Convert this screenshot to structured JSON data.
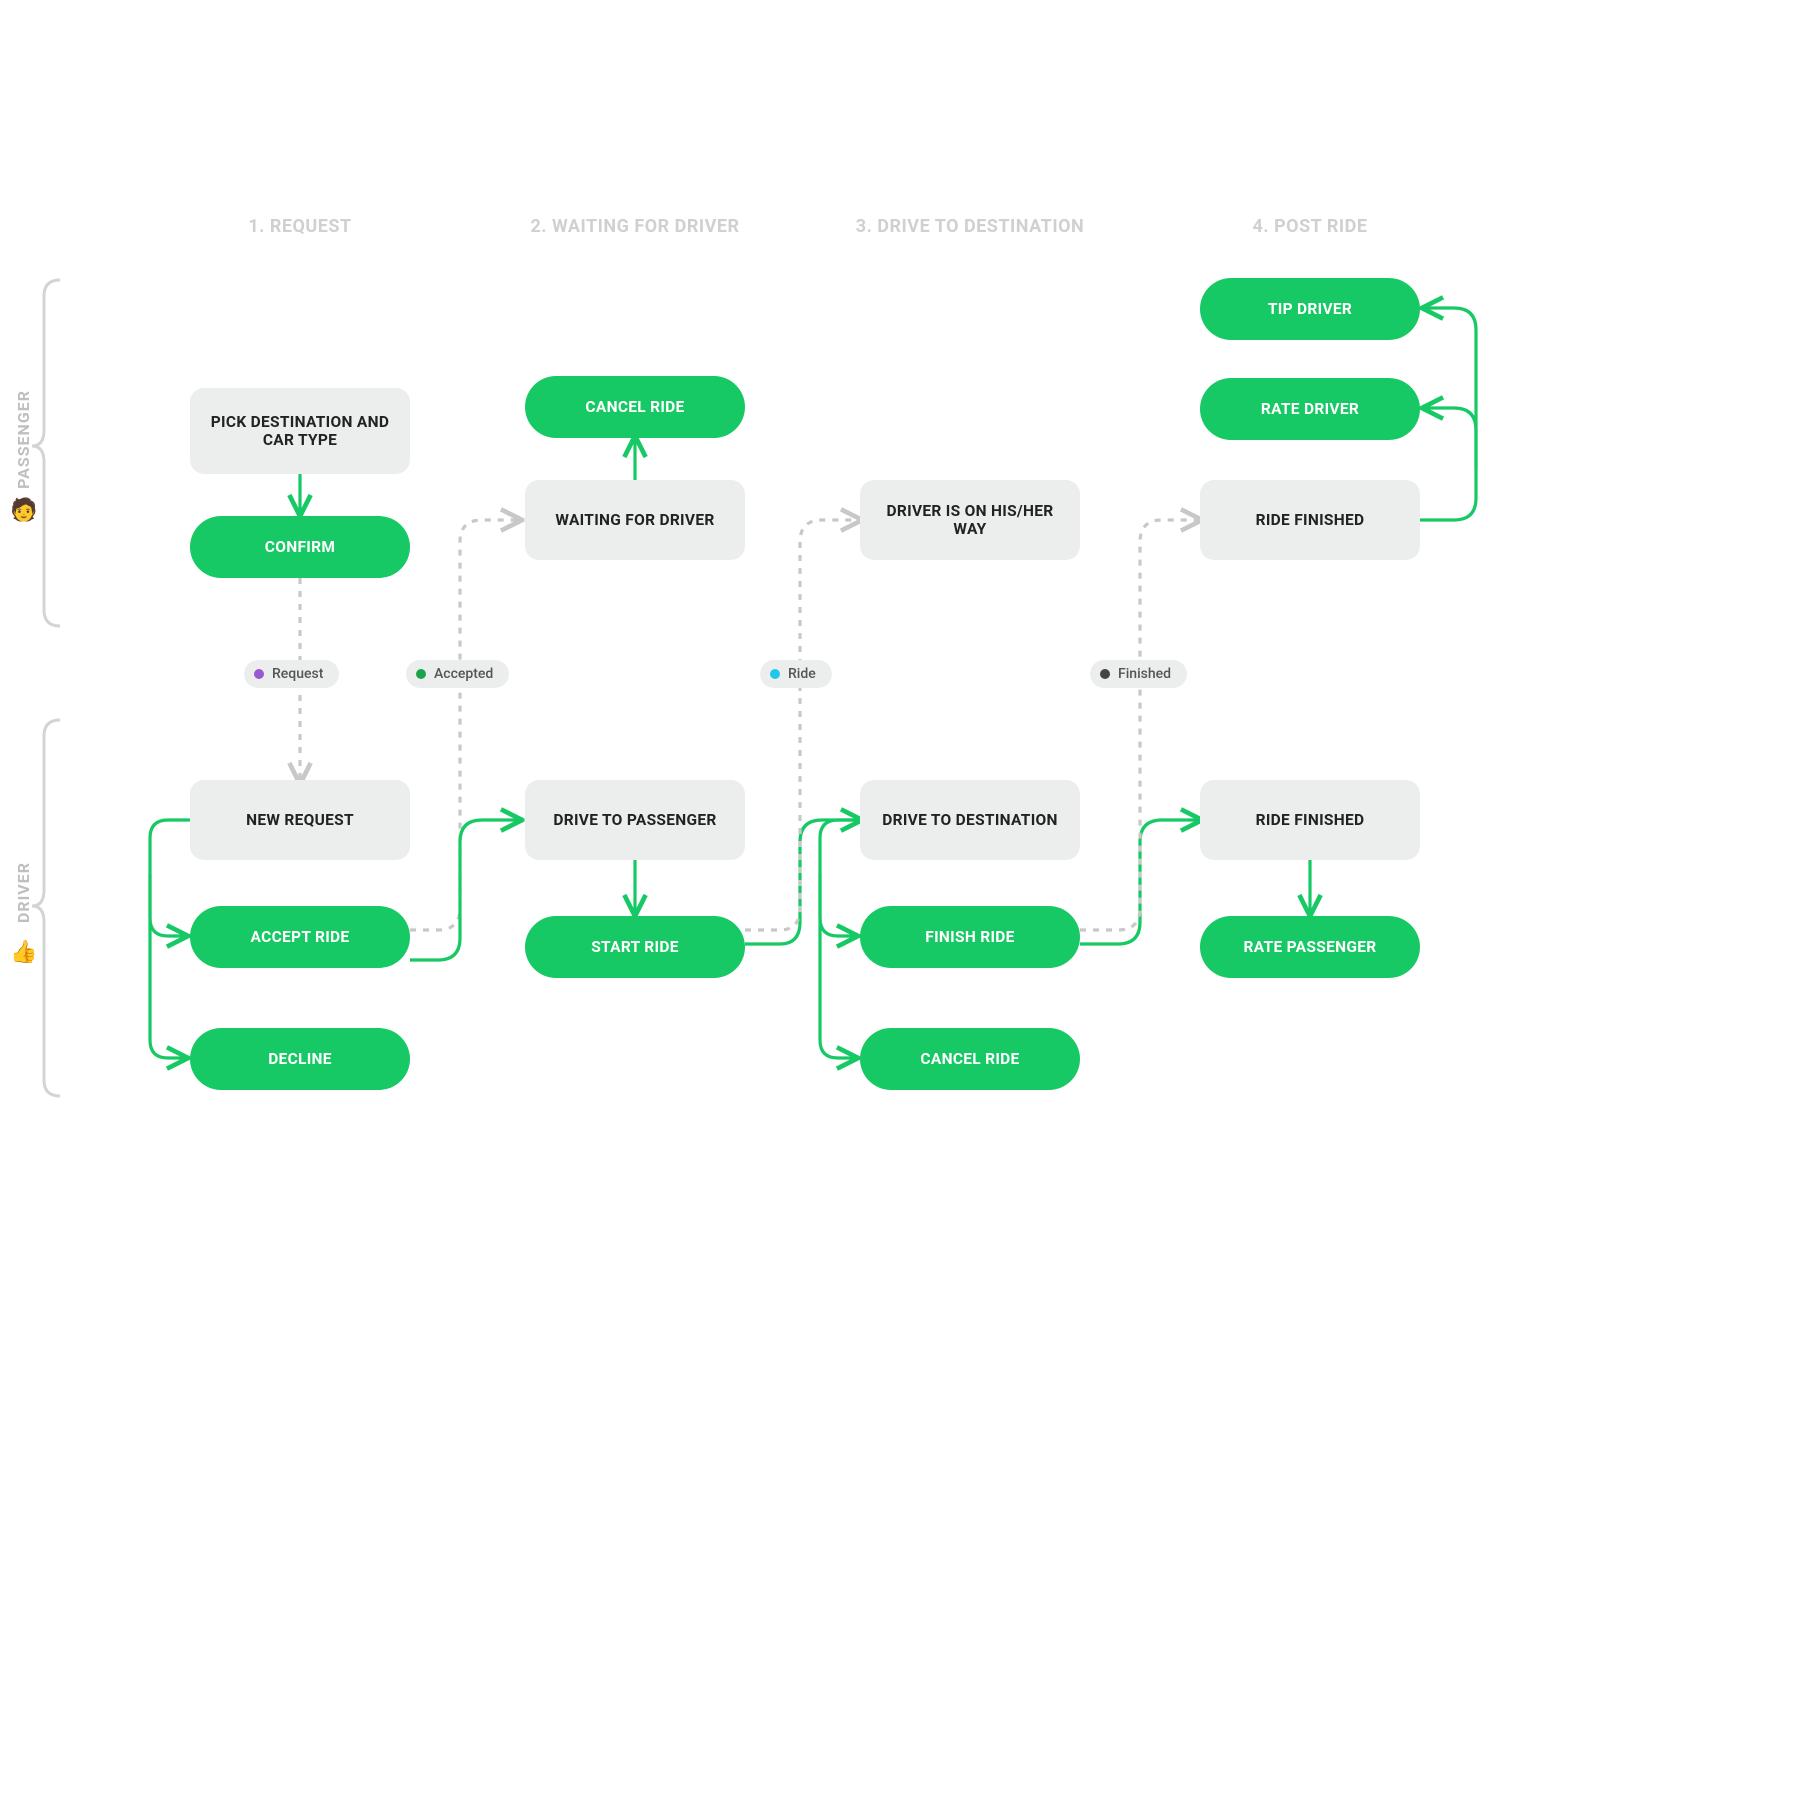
{
  "lanes": {
    "passenger": {
      "label": "PASSENGER",
      "emoji": "🧑"
    },
    "driver": {
      "label": "DRIVER",
      "emoji": "👍"
    }
  },
  "phases": [
    {
      "id": "p1",
      "label": "1. REQUEST"
    },
    {
      "id": "p2",
      "label": "2. WAITING FOR DRIVER"
    },
    {
      "id": "p3",
      "label": "3. DRIVE TO DESTINATION"
    },
    {
      "id": "p4",
      "label": "4. POST RIDE"
    }
  ],
  "badges": [
    {
      "id": "b-request",
      "label": "Request",
      "color": "#9b59d0"
    },
    {
      "id": "b-accepted",
      "label": "Accepted",
      "color": "#1aa34a"
    },
    {
      "id": "b-ride",
      "label": "Ride",
      "color": "#22c7e8"
    },
    {
      "id": "b-finished",
      "label": "Finished",
      "color": "#444444"
    }
  ],
  "nodes": {
    "pickDest": {
      "label": "PICK DESTINATION AND CAR TYPE",
      "type": "state"
    },
    "confirm": {
      "label": "CONFIRM",
      "type": "action"
    },
    "cancelRideP": {
      "label": "CANCEL RIDE",
      "type": "action"
    },
    "waitingDriver": {
      "label": "WAITING FOR DRIVER",
      "type": "state"
    },
    "driverOnWay": {
      "label": "DRIVER IS ON HIS/HER WAY",
      "type": "state"
    },
    "rideFinishedP": {
      "label": "RIDE FINISHED",
      "type": "state"
    },
    "tipDriver": {
      "label": "TIP DRIVER",
      "type": "action"
    },
    "rateDriver": {
      "label": "RATE DRIVER",
      "type": "action"
    },
    "newRequest": {
      "label": "NEW REQUEST",
      "type": "state"
    },
    "acceptRide": {
      "label": "ACCEPT RIDE",
      "type": "action"
    },
    "decline": {
      "label": "DECLINE",
      "type": "action"
    },
    "driveToPassenger": {
      "label": "DRIVE TO PASSENGER",
      "type": "state"
    },
    "startRide": {
      "label": "START RIDE",
      "type": "action"
    },
    "driveToDest": {
      "label": "DRIVE TO DESTINATION",
      "type": "state"
    },
    "finishRide": {
      "label": "FINISH RIDE",
      "type": "action"
    },
    "cancelRideD": {
      "label": "CANCEL RIDE",
      "type": "action"
    },
    "rideFinishedD": {
      "label": "RIDE FINISHED",
      "type": "state"
    },
    "ratePassenger": {
      "label": "RATE PASSENGER",
      "type": "action"
    }
  },
  "connections": [
    {
      "from": "pickDest",
      "to": "confirm",
      "style": "solid"
    },
    {
      "from": "confirm",
      "to": "newRequest",
      "style": "dash",
      "label": "Request"
    },
    {
      "from": "newRequest",
      "to": "acceptRide",
      "style": "solid"
    },
    {
      "from": "newRequest",
      "to": "decline",
      "style": "solid"
    },
    {
      "from": "acceptRide",
      "to": "driveToPassenger",
      "style": "solid"
    },
    {
      "from": "acceptRide",
      "to": "waitingDriver",
      "style": "dash",
      "label": "Accepted"
    },
    {
      "from": "waitingDriver",
      "to": "cancelRideP",
      "style": "solid"
    },
    {
      "from": "driveToPassenger",
      "to": "startRide",
      "style": "solid"
    },
    {
      "from": "startRide",
      "to": "driveToDest",
      "style": "solid"
    },
    {
      "from": "startRide",
      "to": "driverOnWay",
      "style": "dash",
      "label": "Ride"
    },
    {
      "from": "driveToDest",
      "to": "finishRide",
      "style": "solid"
    },
    {
      "from": "driveToDest",
      "to": "cancelRideD",
      "style": "solid"
    },
    {
      "from": "finishRide",
      "to": "rideFinishedD",
      "style": "solid"
    },
    {
      "from": "finishRide",
      "to": "rideFinishedP",
      "style": "dash",
      "label": "Finished"
    },
    {
      "from": "rideFinishedD",
      "to": "ratePassenger",
      "style": "solid"
    },
    {
      "from": "rideFinishedP",
      "to": "rateDriver",
      "style": "solid"
    },
    {
      "from": "rideFinishedP",
      "to": "tipDriver",
      "style": "solid"
    }
  ]
}
